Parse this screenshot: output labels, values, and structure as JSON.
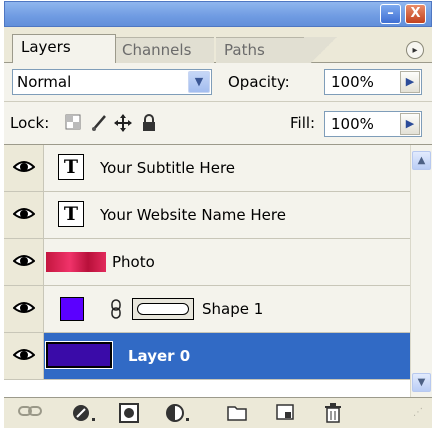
{
  "window": {
    "minimize_icon": "minimize-icon",
    "close_icon": "close-icon",
    "minimize_glyph": "–",
    "close_glyph": "X"
  },
  "tabs": [
    {
      "label": "Layers",
      "active": true
    },
    {
      "label": "Channels",
      "active": false
    },
    {
      "label": "Paths",
      "active": false
    }
  ],
  "blend": {
    "mode": "Normal",
    "opacity_label": "Opacity:",
    "opacity_value": "100%",
    "fill_label": "Fill:",
    "fill_value": "100%"
  },
  "lock": {
    "label": "Lock:",
    "icons": [
      "lock-transparent-pixels-icon",
      "lock-image-pixels-icon",
      "lock-position-icon",
      "lock-all-icon"
    ]
  },
  "layers": [
    {
      "name": "Your Subtitle Here",
      "type": "text",
      "visible": true,
      "selected": false
    },
    {
      "name": "Your Website Name Here",
      "type": "text",
      "visible": true,
      "selected": false
    },
    {
      "name": "Photo",
      "type": "image",
      "visible": true,
      "selected": false,
      "thumb_color": "#e0245e"
    },
    {
      "name": "Shape 1",
      "type": "shape",
      "visible": true,
      "selected": false,
      "thumb_color": "#5b00ff"
    },
    {
      "name": "Layer 0",
      "type": "fill",
      "visible": true,
      "selected": true,
      "thumb_color": "#3a0ba8"
    }
  ],
  "bottom_bar": {
    "icons": [
      "link-layers-icon",
      "layer-style-icon",
      "add-mask-icon",
      "adjustment-layer-icon",
      "new-group-icon",
      "new-layer-icon",
      "delete-layer-icon"
    ]
  },
  "colors": {
    "selection": "#316ac5",
    "titlebar": "#6f9be2"
  }
}
